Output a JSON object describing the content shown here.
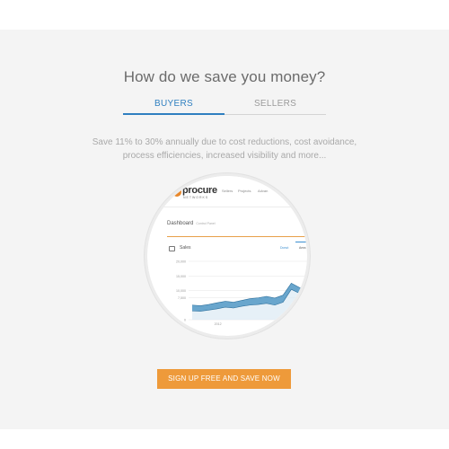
{
  "section": {
    "headline": "How do we save you money?",
    "tabs": [
      {
        "label": "BUYERS",
        "active": true
      },
      {
        "label": "SELLERS",
        "active": false
      }
    ],
    "description": "Save 11% to 30% annually due to cost reductions, cost avoidance, process efficiencies, increased visibility and more...",
    "cta_label": "SIGN UP FREE AND SAVE NOW"
  },
  "preview": {
    "logo_text": "procure",
    "logo_sub": "NETWORKS",
    "nav": [
      "Sellers",
      "Projects",
      "Advan"
    ],
    "dashboard_title": "Dashboard",
    "dashboard_subtitle": "Control Panel",
    "panel_title": "Sales",
    "panel_tabs": [
      "Donut",
      "Area"
    ],
    "panel_icon": "inbox-icon"
  },
  "colors": {
    "accent_blue": "#2f7fc0",
    "cta_orange": "#ee9a3a",
    "chart_blue": "#4f97c4",
    "chart_fill": "#dbe9f3"
  },
  "chart_data": {
    "type": "area",
    "title": "Sales",
    "y_ticks": [
      "20,000",
      "15,000",
      "10,000",
      "7,500",
      "0"
    ],
    "x_ticks": [
      "2012"
    ],
    "ylim": [
      0,
      20000
    ],
    "series": [
      {
        "name": "",
        "values": [
          5000,
          4800,
          5200,
          5800,
          6300,
          6000,
          6600,
          7200,
          7500,
          8000,
          7400,
          8400,
          12500,
          11000,
          9400,
          9000
        ]
      },
      {
        "name": "",
        "values": [
          3000,
          2900,
          3300,
          3700,
          4300,
          4000,
          4600,
          5000,
          5200,
          5600,
          5000,
          6000,
          10400,
          9000,
          7400,
          7100
        ]
      }
    ]
  }
}
